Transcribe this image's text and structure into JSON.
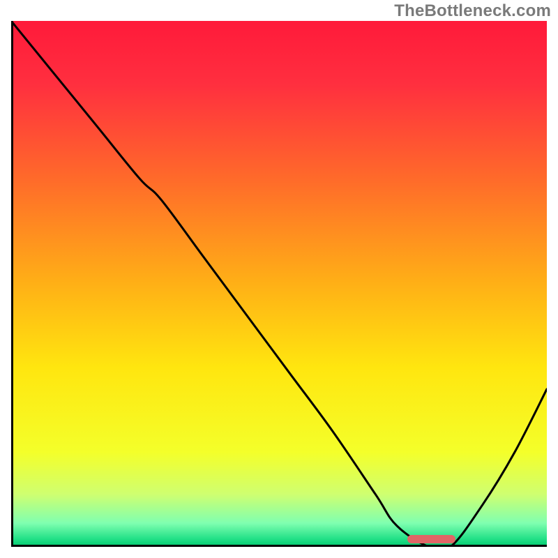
{
  "watermark": "TheBottleneck.com",
  "chart_data": {
    "type": "line",
    "x": [
      0.0,
      0.08,
      0.16,
      0.24,
      0.28,
      0.36,
      0.44,
      0.52,
      0.6,
      0.68,
      0.72,
      0.78,
      0.82,
      0.88,
      0.94,
      1.0
    ],
    "y": [
      1.0,
      0.9,
      0.8,
      0.7,
      0.66,
      0.55,
      0.44,
      0.33,
      0.22,
      0.1,
      0.04,
      0.0,
      0.0,
      0.08,
      0.18,
      0.3
    ],
    "optimum_range_x": [
      0.74,
      0.83
    ],
    "gradient_stops": [
      {
        "offset": 0.0,
        "color": "#ff1a3a"
      },
      {
        "offset": 0.12,
        "color": "#ff2f3f"
      },
      {
        "offset": 0.3,
        "color": "#ff6a2a"
      },
      {
        "offset": 0.5,
        "color": "#ffb016"
      },
      {
        "offset": 0.66,
        "color": "#ffe60f"
      },
      {
        "offset": 0.82,
        "color": "#f4ff2a"
      },
      {
        "offset": 0.9,
        "color": "#cfff70"
      },
      {
        "offset": 0.955,
        "color": "#7fffb0"
      },
      {
        "offset": 0.985,
        "color": "#22e087"
      },
      {
        "offset": 1.0,
        "color": "#00c76e"
      }
    ],
    "marker_color": "#e06666",
    "title": "",
    "xlabel": "",
    "ylabel": "",
    "xlim": [
      0,
      1
    ],
    "ylim": [
      0,
      1
    ]
  }
}
